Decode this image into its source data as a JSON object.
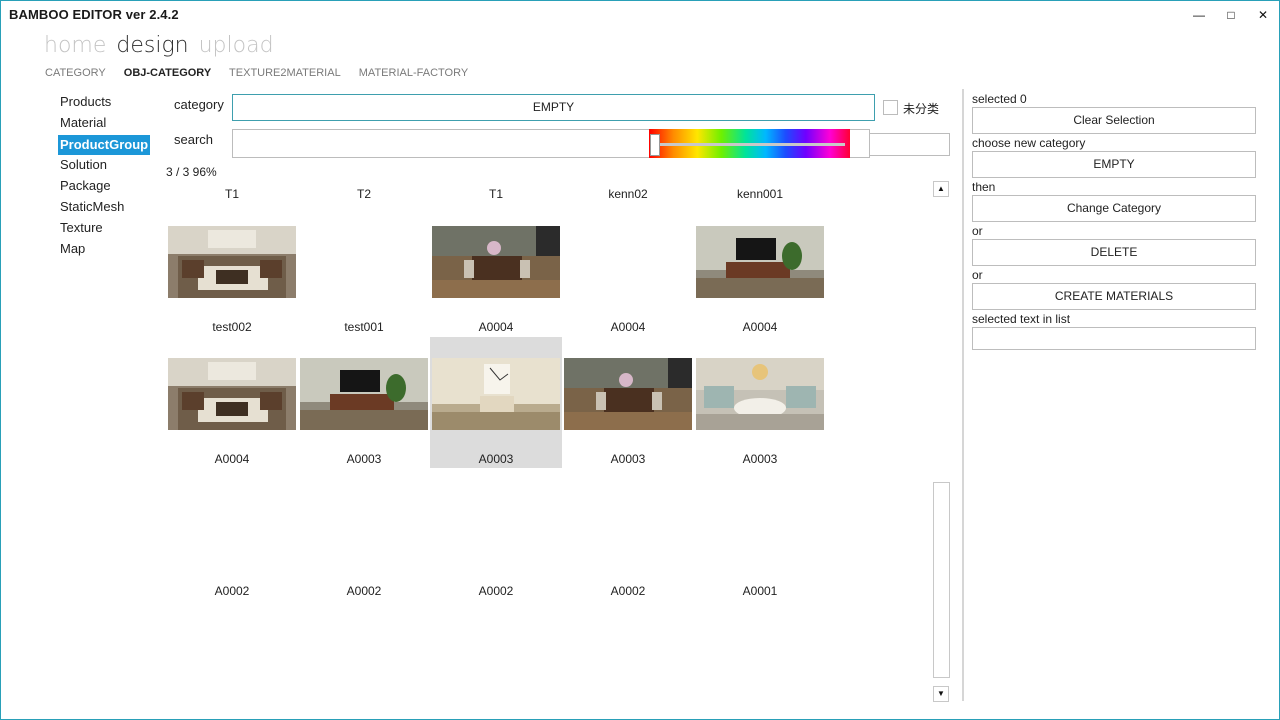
{
  "app": {
    "title": "BAMBOO EDITOR ver 2.4.2",
    "window_controls": {
      "minimize": "—",
      "maximize": "□",
      "close": "✕"
    }
  },
  "nav": {
    "main": [
      {
        "label": "home",
        "active": false
      },
      {
        "label": "design",
        "active": true
      },
      {
        "label": "upload",
        "active": false
      }
    ],
    "sub": [
      {
        "label": "CATEGORY",
        "active": false
      },
      {
        "label": "OBJ-CATEGORY",
        "active": true
      },
      {
        "label": "TEXTURE2MATERIAL",
        "active": false
      },
      {
        "label": "MATERIAL-FACTORY",
        "active": false
      }
    ]
  },
  "sidebar": {
    "items": [
      {
        "label": "Products",
        "active": false
      },
      {
        "label": "Material",
        "active": false
      },
      {
        "label": "ProductGroup",
        "active": true
      },
      {
        "label": "Solution",
        "active": false
      },
      {
        "label": "Package",
        "active": false
      },
      {
        "label": "StaticMesh",
        "active": false
      },
      {
        "label": "Texture",
        "active": false
      },
      {
        "label": "Map",
        "active": false
      }
    ]
  },
  "filters": {
    "category_label": "category",
    "category_value": "EMPTY",
    "uncategorized_label": "未分类",
    "uncategorized_checked": false,
    "search_label": "search",
    "search_value": "",
    "slider_level": 0
  },
  "results": {
    "count_text": "3 / 3 96%"
  },
  "grid": {
    "header_labels": [
      "T1",
      "T2",
      "T1",
      "kenn02",
      "kenn001"
    ],
    "rows": [
      [
        {
          "name": "test002",
          "icon": "living-room-thumbnail"
        },
        {
          "name": "test001",
          "icon": ""
        },
        {
          "name": "A0004",
          "icon": "dining-room-thumbnail"
        },
        {
          "name": "A0004",
          "icon": ""
        },
        {
          "name": "A0004",
          "icon": "tv-room-thumbnail"
        }
      ],
      [
        {
          "name": "A0004",
          "icon": "living-room-thumbnail"
        },
        {
          "name": "A0003",
          "icon": "tv-room-thumbnail"
        },
        {
          "name": "A0003",
          "icon": "bedroom-thumbnail",
          "selected": true
        },
        {
          "name": "A0003",
          "icon": "dining-room-thumbnail"
        },
        {
          "name": "A0003",
          "icon": "lounge-thumbnail"
        }
      ],
      [
        {
          "name": "A0002",
          "icon": ""
        },
        {
          "name": "A0002",
          "icon": ""
        },
        {
          "name": "A0002",
          "icon": ""
        },
        {
          "name": "A0002",
          "icon": ""
        },
        {
          "name": "A0001",
          "icon": ""
        }
      ]
    ]
  },
  "right_panel": {
    "selected_label": "selected 0",
    "clear_button": "Clear Selection",
    "choose_label": "choose new category",
    "category_button": "EMPTY",
    "then_label": "then",
    "change_button": "Change Category",
    "or1_label": "or",
    "delete_button": "DELETE",
    "or2_label": "or",
    "create_button": "CREATE MATERIALS",
    "selected_text_label": "selected text in list",
    "selected_text_value": ""
  },
  "colors": {
    "accent": "#1c97d8",
    "border_accent": "#3e9fae",
    "window_border": "#29a0b8",
    "selected_cell": "#dcdcdc"
  }
}
